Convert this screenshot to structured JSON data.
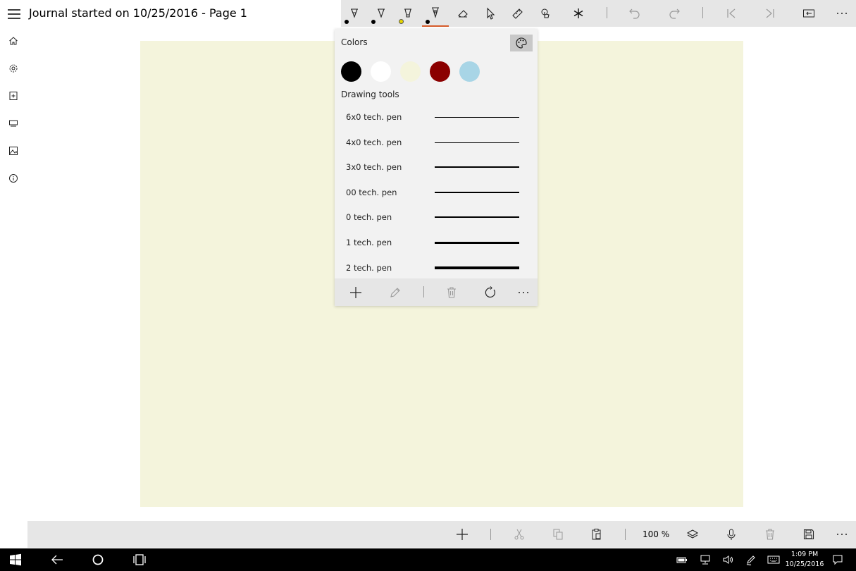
{
  "app": {
    "title": "Journal started on 10/25/2016 - Page 1"
  },
  "nav": {
    "items": [
      "home",
      "settings",
      "add-page",
      "pages",
      "gallery",
      "about"
    ]
  },
  "top_toolbar": {
    "tools": [
      "ballpoint-pen",
      "pencil",
      "highlighter",
      "technical-pen",
      "eraser",
      "lasso-select",
      "ruler",
      "touch-writing",
      "favorites"
    ],
    "active_tool": "technical-pen",
    "pen_dot_colors": [
      "#000000",
      "#000000",
      "#e5d400",
      "#000000"
    ],
    "accent": "#d55b2a"
  },
  "flyout": {
    "colors_label": "Colors",
    "colors": [
      "#000000",
      "#ffffff",
      "#f4f4dc",
      "#8b0000",
      "#a8d5e6"
    ],
    "tools_label": "Drawing tools",
    "pens": [
      {
        "name": "6x0 tech. pen",
        "thickness": 1
      },
      {
        "name": "4x0 tech. pen",
        "thickness": 1
      },
      {
        "name": "3x0 tech. pen",
        "thickness": 1.5
      },
      {
        "name": "00 tech. pen",
        "thickness": 2
      },
      {
        "name": "0 tech. pen",
        "thickness": 2
      },
      {
        "name": "1 tech. pen",
        "thickness": 3
      },
      {
        "name": "2 tech. pen",
        "thickness": 4
      }
    ]
  },
  "canvas": {
    "background": "#f4f4dc"
  },
  "bottom_bar": {
    "zoom": "100 %"
  },
  "taskbar": {
    "time": "1:09 PM",
    "date": "10/25/2016"
  }
}
